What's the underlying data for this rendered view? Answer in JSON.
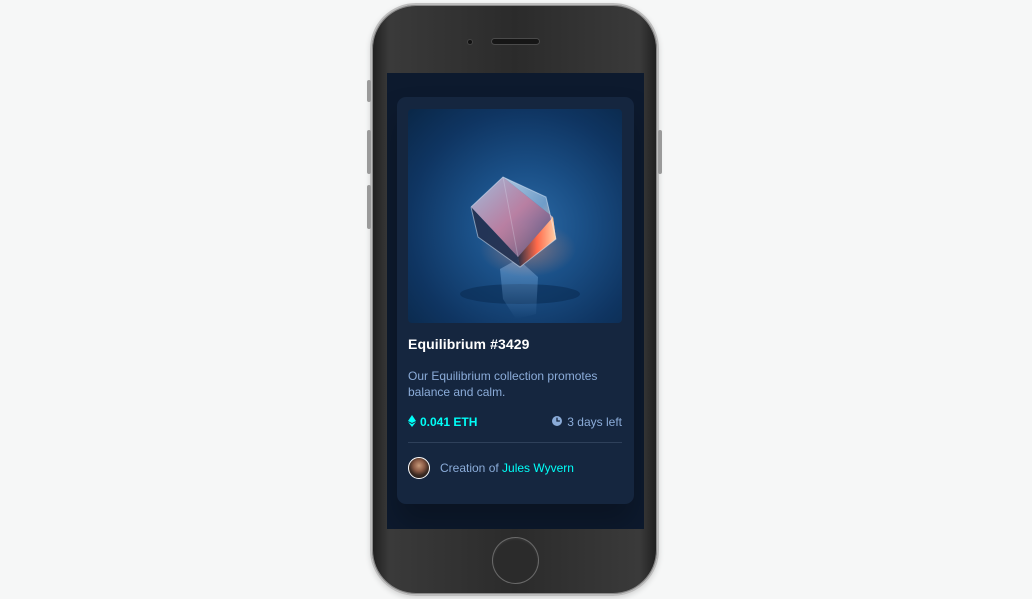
{
  "card": {
    "title": "Equilibrium #3429",
    "description": "Our Equilibrium collection promotes balance and calm.",
    "price": "0.041 ETH",
    "time_left": "3 days left",
    "creation_prefix": "Creation of",
    "creator_name": "Jules Wyvern"
  },
  "icons": {
    "price": "ethereum-icon",
    "time": "clock-icon",
    "avatar": "avatar"
  },
  "colors": {
    "page_bg": "#f6f7f7",
    "screen_bg": "#0d1a2e",
    "card_bg": "#15263f",
    "accent_cyan": "#00fff8",
    "soft_blue": "#8bacd9",
    "title_white": "#ffffff"
  }
}
